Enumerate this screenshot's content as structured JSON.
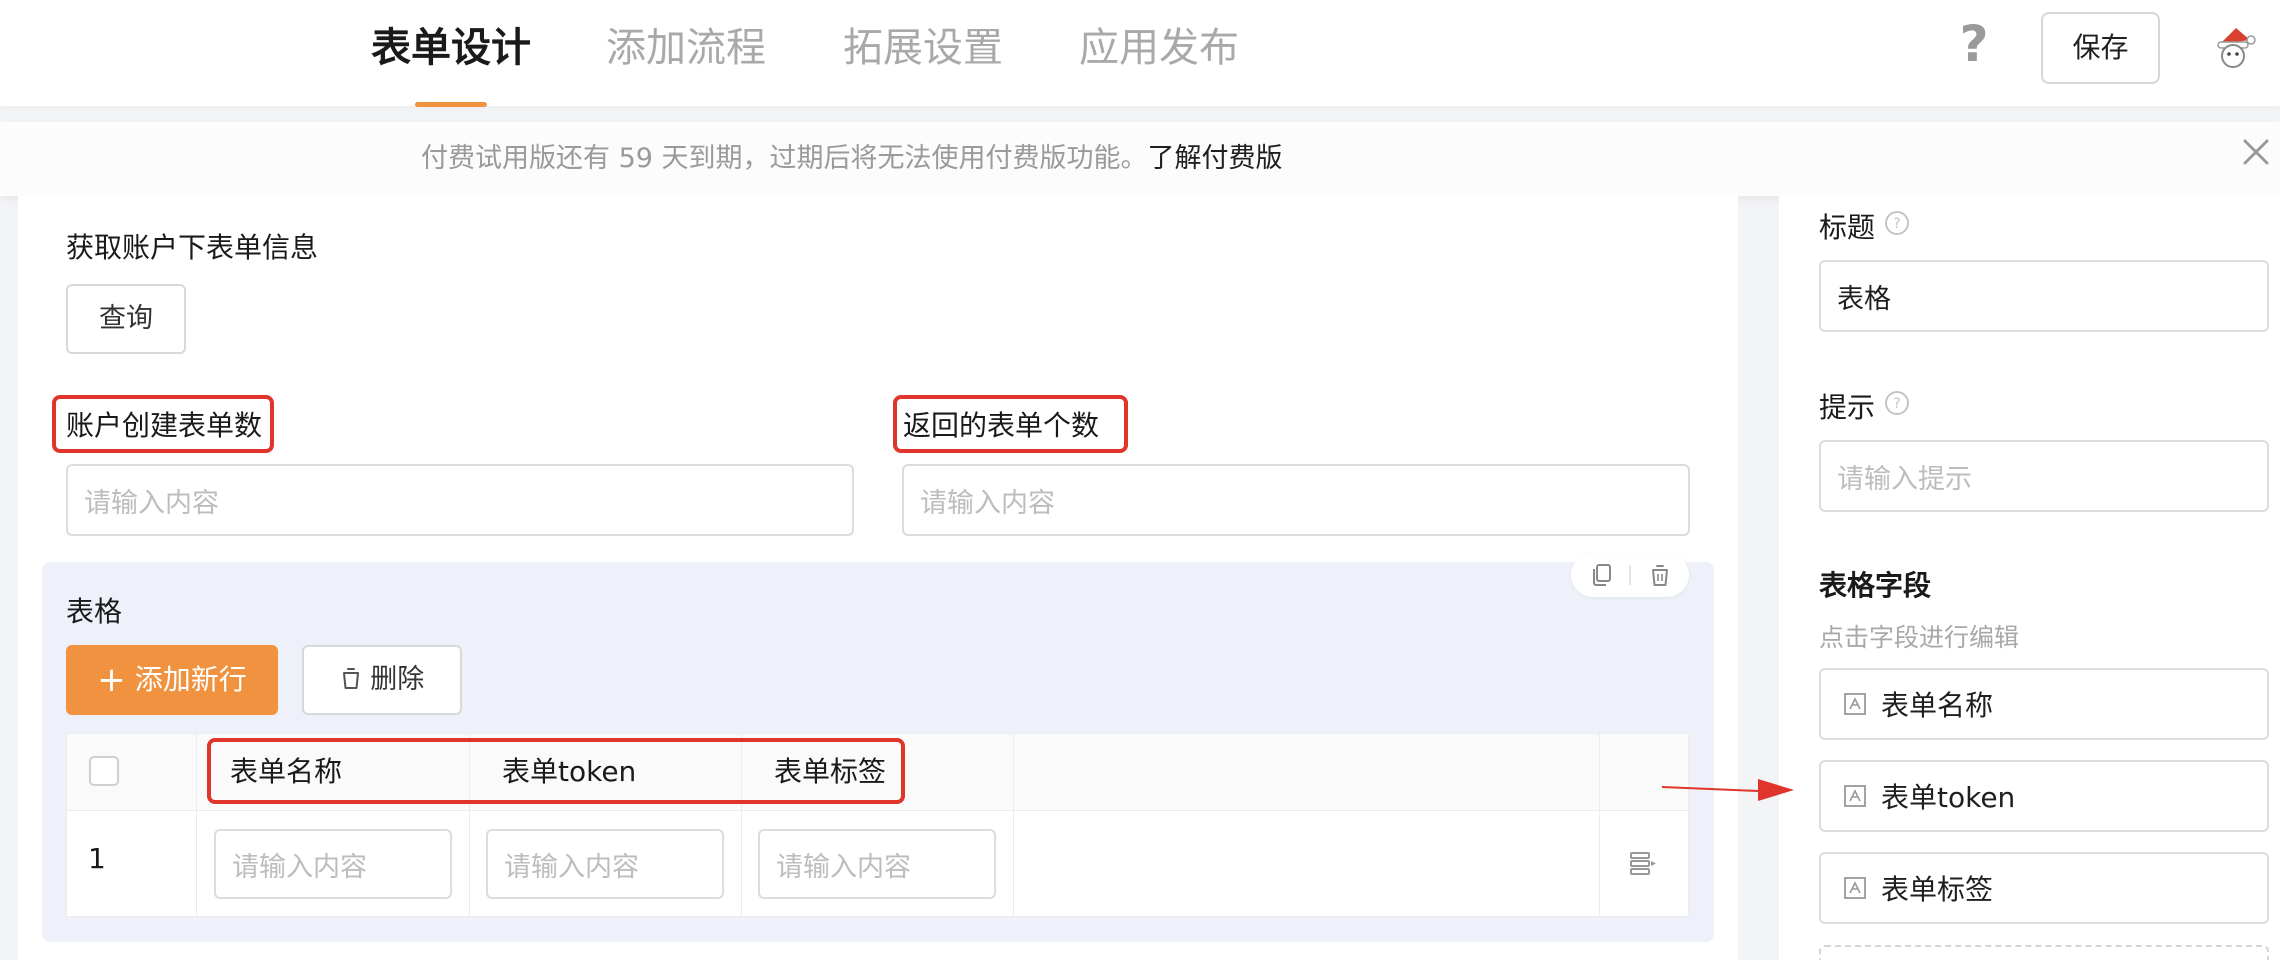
{
  "nav": {
    "tabs": [
      {
        "label": "表单设计",
        "active": true
      },
      {
        "label": "添加流程",
        "active": false
      },
      {
        "label": "拓展设置",
        "active": false
      },
      {
        "label": "应用发布",
        "active": false
      }
    ],
    "help": "?",
    "save_label": "保存",
    "accent": "#f0923f"
  },
  "notice": {
    "text": "付费试用版还有 59 天到期，过期后将无法使用付费版功能。",
    "link": "了解付费版"
  },
  "form": {
    "section_title": "获取账户下表单信息",
    "query_button": "查询",
    "field1": {
      "label": "账户创建表单数",
      "placeholder": "请输入内容"
    },
    "field2": {
      "label": "返回的表单个数",
      "placeholder": "请输入内容"
    },
    "table": {
      "title": "表格",
      "add_row_button": "添加新行",
      "delete_button": "删除",
      "columns": [
        "表单名称",
        "表单token",
        "表单标签"
      ],
      "rows": [
        {
          "index": "1",
          "cells": [
            "请输入内容",
            "请输入内容",
            "请输入内容"
          ]
        }
      ]
    },
    "highlight_color": "#e0352b"
  },
  "panel": {
    "title_label": "标题",
    "title_value": "表格",
    "hint_label": "提示",
    "hint_placeholder": "请输入提示",
    "fields_label": "表格字段",
    "fields_hint": "点击字段进行编辑",
    "fields": [
      "表单名称",
      "表单token",
      "表单标签"
    ]
  },
  "icons": {
    "help": "question-mark-icon",
    "avatar": "santa-avatar-icon",
    "close": "close-icon",
    "copy": "copy-icon",
    "trash": "trash-icon",
    "plus": "plus-icon",
    "row_action": "row-action-icon",
    "text_field": "text-field-icon",
    "arrow": "red-arrow-icon"
  }
}
